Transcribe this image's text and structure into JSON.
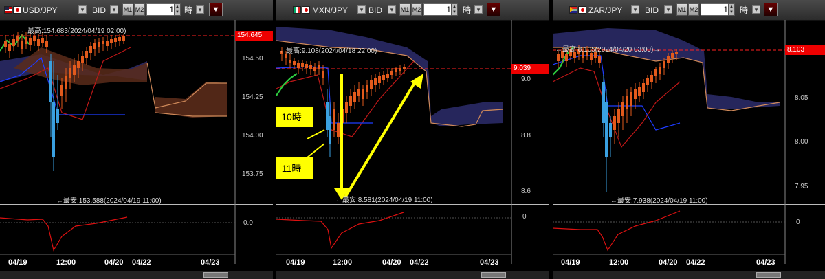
{
  "panels": [
    {
      "id": "usdjpy",
      "flags": [
        "us",
        "jp"
      ],
      "pair": "USD/JPY",
      "price_type": "BID",
      "period_value": "1",
      "period_unit": "時",
      "high_label": "←最高:154.683(2024/04/19 02:00)",
      "low_label": "←最安:153.588(2024/04/19 11:00)",
      "current_price": "154.645",
      "y_ticks": [
        "154.50",
        "154.25",
        "154.00",
        "153.75"
      ],
      "osc_zero": "0.0",
      "dates": [
        "04/19",
        "12:00",
        "04/20",
        "04/22",
        "04/23"
      ]
    },
    {
      "id": "mxnjpy",
      "flags": [
        "mx",
        "jp"
      ],
      "pair": "MXN/JPY",
      "price_type": "BID",
      "period_value": "1",
      "period_unit": "時",
      "high_label": "←最高:9.108(2024/04/18 22:00)",
      "low_label": "←最安:8.581(2024/04/19 11:00)",
      "current_price": "9.039",
      "y_ticks": [
        "9.0",
        "8.8",
        "8.6"
      ],
      "osc_zero": "0",
      "dates": [
        "04/19",
        "12:00",
        "04/20",
        "04/22",
        "04/23"
      ],
      "callouts": [
        "10時",
        "11時"
      ]
    },
    {
      "id": "zarjpy",
      "flags": [
        "za",
        "jp"
      ],
      "pair": "ZAR/JPY",
      "price_type": "BID",
      "period_value": "1",
      "period_unit": "時",
      "high_label": "←最高:8.105(2024/04/20 03:00)→",
      "low_label": "←最安:7.938(2024/04/19 11:00)",
      "current_price": "8.103",
      "y_ticks": [
        "8.05",
        "8.00",
        "7.95"
      ],
      "osc_zero": "0",
      "dates": [
        "04/19",
        "12:00",
        "04/20",
        "04/22",
        "04/23"
      ]
    }
  ],
  "toolbar": {
    "m1": "M1",
    "m2": "M2",
    "menu_glyph": "▼",
    "check_glyph": "▾",
    "spin_up": "▲",
    "spin_down": "▼"
  },
  "colors": {
    "up_candle": "#e25a1c",
    "down_candle": "#3aa0e0",
    "cloud": "#2a2a66",
    "cloud_bear": "#5a2b1a",
    "tenkan": "#1e3cff",
    "kijun": "#c01818",
    "chikou": "#2ecc40",
    "oscillator": "#dd1111",
    "price_line": "#ff2020",
    "callout_bg": "#ffff00"
  }
}
